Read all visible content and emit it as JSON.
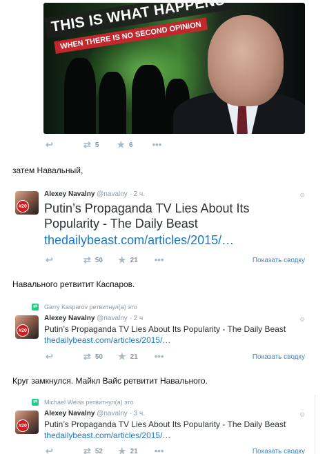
{
  "media": {
    "headline": "THIS IS WHAT HAPPENS",
    "subline": "WHEN THERE IS NO SECOND OPINION"
  },
  "top_actions": {
    "retweets": "5",
    "favorites": "6"
  },
  "comment1": "затем Навальный,",
  "tweet1": {
    "name": "Alexey Navalny",
    "handle": "@navalny",
    "time": "· 2 ч.",
    "text": "Putin’s Propaganda TV Lies About Its Popularity - The Daily Beast",
    "link": "thedailybeast.com/articles/2015/…",
    "avatar_badge": "#20",
    "retweets": "50",
    "favorites": "21",
    "summary": "Показать сводку"
  },
  "comment2": "Навального ретвитит Каспаров.",
  "tweet2": {
    "retweeted_by": "Garry Kasparov ретвитнул(а) это",
    "name": "Alexey Navalny",
    "handle": "@navalny",
    "time": "· 2 ч",
    "text": "Putin’s Propaganda TV Lies About Its Popularity - The Daily Beast",
    "link": "thedailybeast.com/articles/2015/…",
    "avatar_badge": "#20",
    "retweets": "50",
    "favorites": "21",
    "summary": "Показать сводку"
  },
  "comment3": "Круг замкнулся. Майкл Вайс ретвитит Навального.",
  "tweet3": {
    "retweeted_by": "Michael Weiss ретвитнул(а) это",
    "name": "Alexey Navalny",
    "handle": "@navalny",
    "time": "· 3 ч.",
    "text": "Putin’s Propaganda TV Lies About Its Popularity - The Daily Beast",
    "link": "thedailybeast.com/articles/2015/…",
    "avatar_badge": "#20",
    "retweets": "52",
    "favorites": "21",
    "summary": "Показать сводку"
  },
  "colors": {
    "link": "#1b78c2",
    "retweet_badge": "#19cf86",
    "badge_red": "#d71920"
  }
}
